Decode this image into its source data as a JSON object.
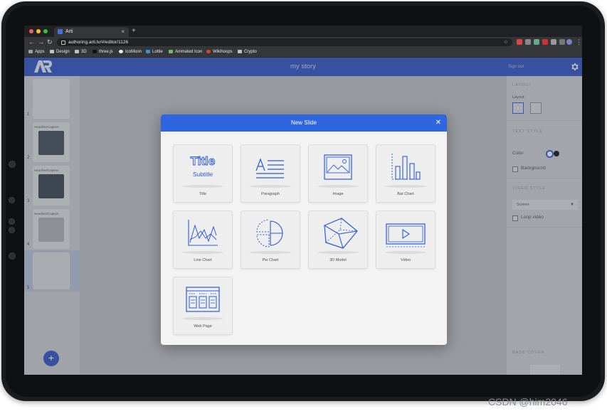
{
  "browser": {
    "tab_title": "Arti",
    "tab_close": "×",
    "new_tab": "+",
    "url": "authoring.arti.tv/#/editor/1126",
    "bookmarks": [
      "Apps",
      "Design",
      "3D",
      "three.js",
      "IcoMoon",
      "Lottie",
      "Animated Icon",
      "Wikihoops",
      "Crypto"
    ]
  },
  "app": {
    "logo_text": "AR",
    "title": "my story",
    "sign_out": "Sign out"
  },
  "slides": [
    {
      "number": "1",
      "label": ""
    },
    {
      "number": "2",
      "label": "Headline/Caption"
    },
    {
      "number": "3",
      "label": "Headline/Caption"
    },
    {
      "number": "4",
      "label": "Headline/Caption"
    },
    {
      "number": "5",
      "label": ""
    }
  ],
  "add_slide": "+",
  "right_panel": {
    "layout_heading": "LAYOUT",
    "layout_label": "Layout",
    "text_style_heading": "TEXT STYLE",
    "color_label": "Color",
    "background_label": "Background",
    "video_style_heading": "VIDEO STYLE",
    "video_select": "Screen",
    "loop_video_label": "Loop video",
    "base_cover_heading": "BASE COVER"
  },
  "modal": {
    "title": "New Slide",
    "close": "✕",
    "cards": [
      {
        "label": "Title",
        "icon": "title-icon"
      },
      {
        "label": "Paragraph",
        "icon": "paragraph-icon"
      },
      {
        "label": "Image",
        "icon": "image-icon"
      },
      {
        "label": "Bar Chart",
        "icon": "bar-chart-icon"
      },
      {
        "label": "Line Chart",
        "icon": "line-chart-icon"
      },
      {
        "label": "Pie Chart",
        "icon": "pie-chart-icon"
      },
      {
        "label": "3D Model",
        "icon": "cube-icon"
      },
      {
        "label": "Video",
        "icon": "video-icon"
      },
      {
        "label": "Web Page",
        "icon": "web-page-icon"
      }
    ],
    "title_card_big": "Title",
    "title_card_small": "Subtitle"
  },
  "watermark": "CSDN @him2046",
  "colors": {
    "accent": "#2e66e0",
    "header": "#2b4fc1",
    "icon_stroke": "#2b5ad8"
  }
}
